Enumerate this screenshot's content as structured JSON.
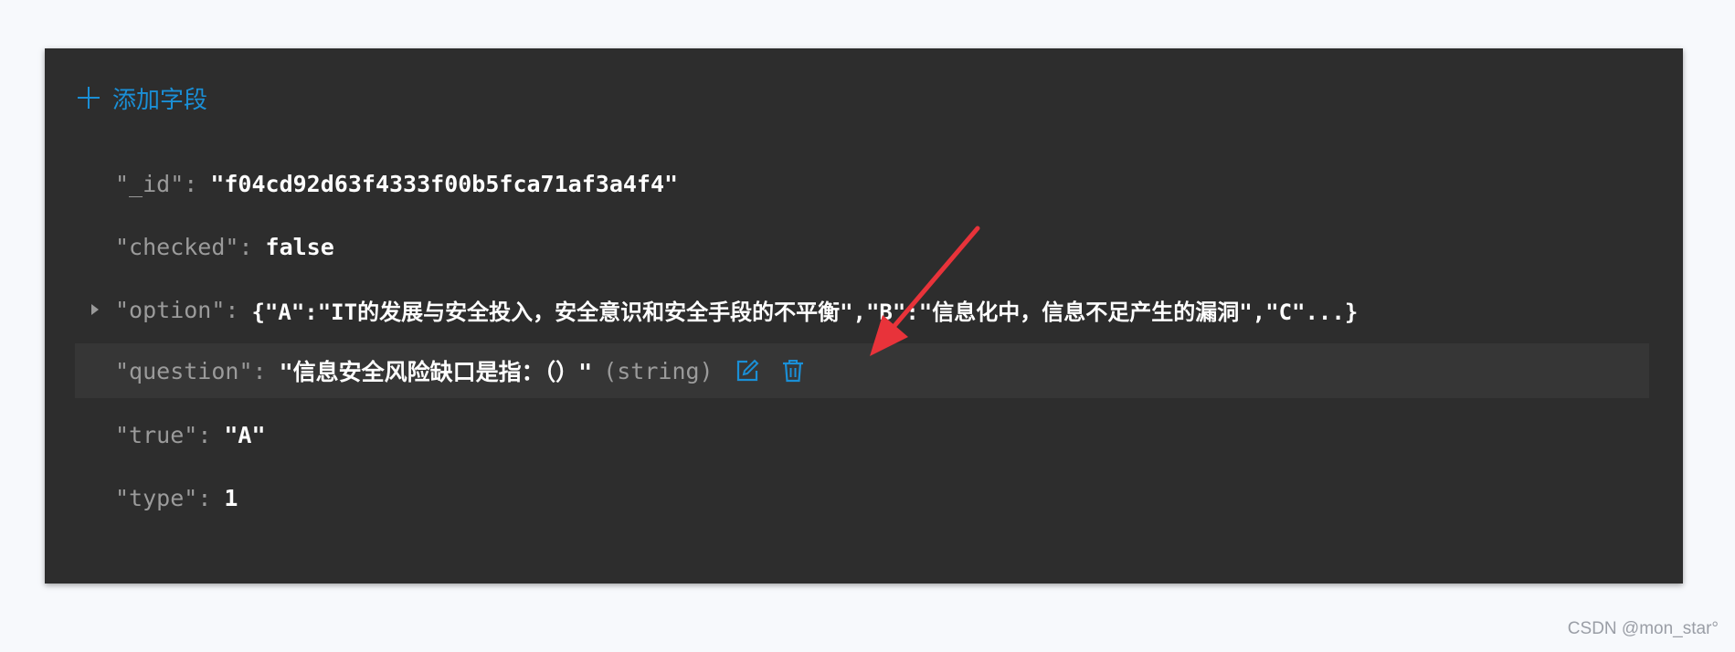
{
  "toolbar": {
    "add_field_label": "添加字段"
  },
  "fields": [
    {
      "key": "\"_id\"",
      "colon": ":",
      "value": "\"f04cd92d63f4333f00b5fca71af3a4f4\""
    },
    {
      "key": "\"checked\"",
      "colon": ":",
      "value": "false"
    },
    {
      "key": "\"option\"",
      "colon": ":",
      "value": "{\"A\":\"IT的发展与安全投入，安全意识和安全手段的不平衡\",\"B\":\"信息化中，信息不足产生的漏洞\",\"C\"...}"
    },
    {
      "key": "\"question\"",
      "colon": ":",
      "value": "\"信息安全风险缺口是指：（）\"",
      "type_hint": "(string)"
    },
    {
      "key": "\"true\"",
      "colon": ":",
      "value": "\"A\""
    },
    {
      "key": "\"type\"",
      "colon": ":",
      "value": "1"
    }
  ],
  "colors": {
    "accent": "#1a8fd6",
    "panel_bg": "#2d2d2d",
    "highlight_row": "#363636",
    "annotation_arrow": "#e8333a"
  },
  "icons": {
    "add": "plus-icon",
    "edit": "edit-icon",
    "delete": "trash-icon",
    "expand": "caret-right-icon"
  },
  "watermark": "CSDN @mon_star°"
}
